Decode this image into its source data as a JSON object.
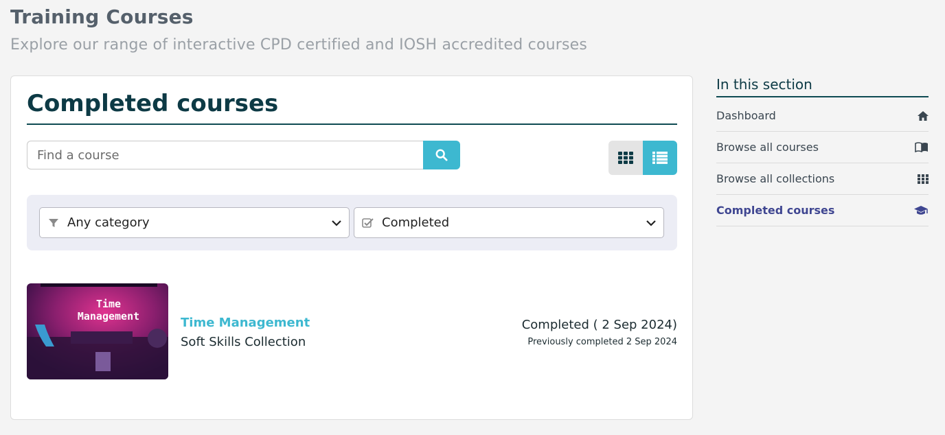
{
  "page": {
    "title": "Training Courses",
    "subtitle": "Explore our range of interactive CPD certified and IOSH accredited courses"
  },
  "main": {
    "heading": "Completed courses",
    "search": {
      "placeholder": "Find a course",
      "value": "",
      "button_icon": "search-icon"
    },
    "view_toggle": {
      "options": [
        "grid-view-icon",
        "list-view-icon"
      ],
      "active": "list"
    },
    "filters": {
      "category": {
        "icon": "filter-icon",
        "selected": "Any category"
      },
      "status": {
        "icon": "checkbox-icon",
        "selected": "Completed"
      }
    },
    "courses": [
      {
        "title": "Time Management",
        "collection": "Soft Skills Collection",
        "status": "Completed ( 2 Sep 2024)",
        "previous": "Previously completed 2 Sep 2024",
        "thumbnail_text_line1": "Time",
        "thumbnail_text_line2": "Management"
      }
    ]
  },
  "sidebar": {
    "title": "In this section",
    "items": [
      {
        "label": "Dashboard",
        "icon": "home-icon",
        "active": false
      },
      {
        "label": "Browse all courses",
        "icon": "book-icon",
        "active": false
      },
      {
        "label": "Browse all collections",
        "icon": "grid-icon",
        "active": false
      },
      {
        "label": "Completed courses",
        "icon": "graduation-cap-icon",
        "active": true
      }
    ]
  },
  "colors": {
    "accent": "#3db8d0",
    "heading": "#0d3a45",
    "active_nav": "#3f4691",
    "filter_panel": "#ecedf5"
  }
}
